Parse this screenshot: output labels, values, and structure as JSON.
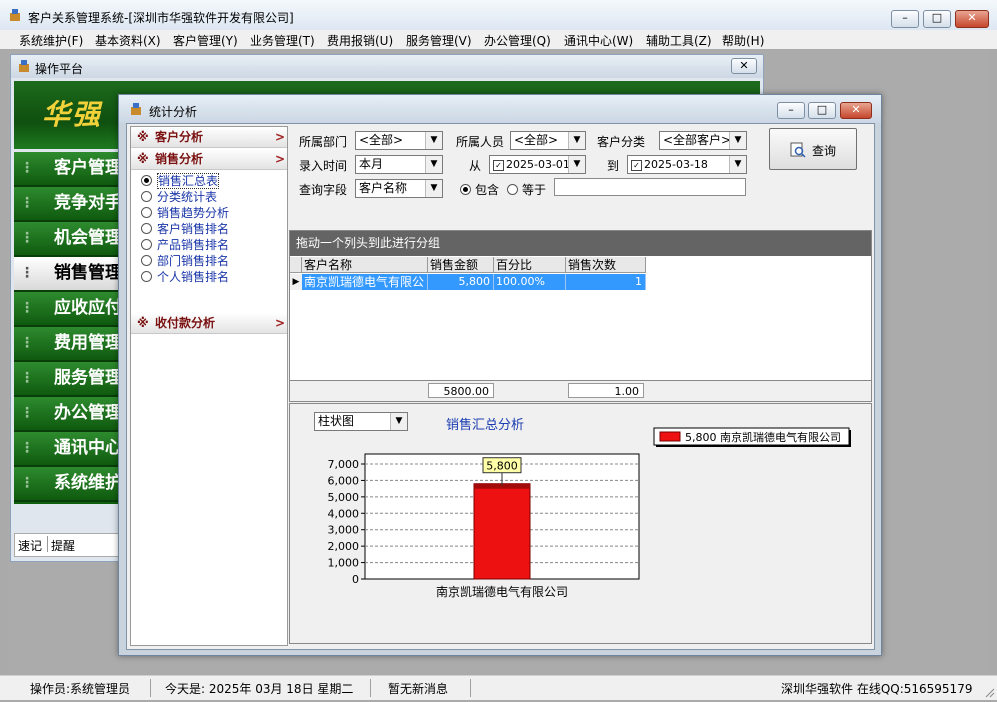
{
  "app": {
    "title": "客户关系管理系统-[深圳市华强软件开发有限公司]",
    "menu": [
      "系统维护(F)",
      "基本资料(X)",
      "客户管理(Y)",
      "业务管理(T)",
      "费用报销(U)",
      "服务管理(V)",
      "办公管理(Q)",
      "通讯中心(W)",
      "辅助工具(Z)",
      "帮助(H)"
    ]
  },
  "platform": {
    "title": "操作平台",
    "logo": "华强",
    "nav": [
      "客户管理",
      "竞争对手",
      "机会管理",
      "销售管理",
      "应收应付",
      "费用管理",
      "服务管理",
      "办公管理",
      "通讯中心",
      "系统维护"
    ],
    "selected_nav": "销售管理",
    "bottom_tabs": [
      "速记",
      "提醒"
    ]
  },
  "stat": {
    "title": "统计分析",
    "groups": [
      {
        "label": "客户分析",
        "arrow": ">"
      },
      {
        "label": "销售分析",
        "arrow": ">"
      },
      {
        "label": "收付款分析",
        "arrow": ">"
      }
    ],
    "group_mark": "※",
    "sales_items": [
      "销售汇总表",
      "分类统计表",
      "销售趋势分析",
      "客户销售排名",
      "产品销售排名",
      "部门销售排名",
      "个人销售排名"
    ],
    "selected_item": "销售汇总表",
    "filters": {
      "dept_label": "所属部门",
      "dept_value": "<全部>",
      "staff_label": "所属人员",
      "staff_value": "<全部>",
      "custtype_label": "客户分类",
      "custtype_value": "<全部客户>",
      "time_label": "录入时间",
      "time_value": "本月",
      "from_label": "从",
      "from_date": "2025-03-01",
      "to_label": "到",
      "to_date": "2025-03-18",
      "field_label": "查询字段",
      "field_value": "客户名称",
      "contains_label": "包含",
      "equals_label": "等于",
      "match_mode": "包含",
      "query_value": ""
    },
    "query_button": "查询",
    "grid": {
      "group_hint": "拖动一个列头到此进行分组",
      "columns": [
        "客户名称",
        "销售金额",
        "百分比",
        "销售次数"
      ],
      "rows": [
        [
          "南京凯瑞德电气有限公",
          "5,800",
          "100.00%",
          "1"
        ]
      ],
      "footer": {
        "amount_total": "5800.00",
        "count_total": "1.00"
      }
    },
    "chart_type_select": "柱状图",
    "chart_title": "销售汇总分析"
  },
  "chart_data": {
    "type": "bar",
    "categories": [
      "南京凯瑞德电气有限公司"
    ],
    "values": [
      5800
    ],
    "data_labels": [
      "5,800"
    ],
    "legend": [
      "5,800 南京凯瑞德电气有限公司"
    ],
    "legend_position": "top-right",
    "ylim": [
      0,
      7000
    ],
    "yticks": [
      "0",
      "1,000",
      "2,000",
      "3,000",
      "4,000",
      "5,000",
      "6,000",
      "7,000"
    ],
    "grid": true,
    "color": "#ee1111"
  },
  "status": {
    "operator": "操作员:系统管理员",
    "today": "今天是: 2025年 03月 18日  星期二",
    "message": "暂无新消息",
    "company": "深圳华强软件 在线QQ:516595179"
  }
}
